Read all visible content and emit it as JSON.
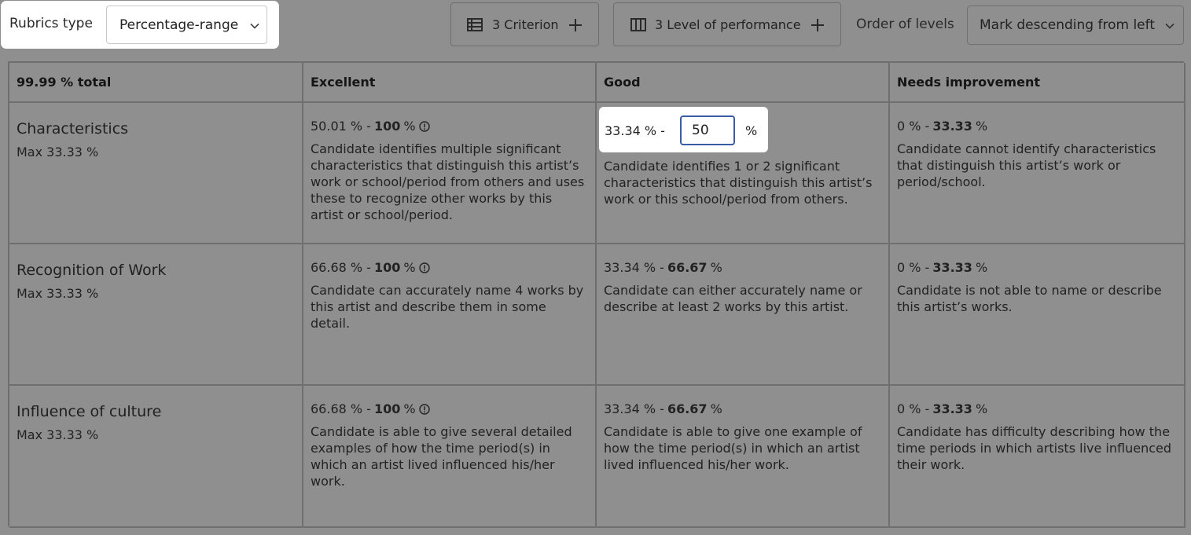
{
  "toolbar": {
    "rubrics_type_label": "Rubrics type",
    "rubrics_type_value": "Percentage-range",
    "criterion_button": "3 Criterion",
    "levels_button": "3 Level of performance",
    "order_label": "Order of levels",
    "order_value": "Mark descending from left"
  },
  "table": {
    "total_header": "99.99 % total",
    "levels": [
      "Excellent",
      "Good",
      "Needs improvement"
    ],
    "criteria": [
      {
        "name": "Characteristics",
        "max": "Max 33.33 %",
        "cells": [
          {
            "from": "50.01 % -",
            "to": "100",
            "unit": "%",
            "desc": "Candidate identifies multiple significant characteristics that distinguish this artist’s work or school/period from others and uses these to recognize other works by this artist or school/period."
          },
          {
            "from": "33.34 % -",
            "to": "50",
            "unit": "%",
            "desc": "Candidate identifies 1 or 2 significant characteristics that distinguish this artist’s work or this school/period from others."
          },
          {
            "from": "0 % -",
            "to": "33.33",
            "unit": "%",
            "desc": "Candidate cannot identify characteristics that distinguish this artist’s work or period/school."
          }
        ]
      },
      {
        "name": "Recognition of Work",
        "max": "Max 33.33 %",
        "cells": [
          {
            "from": "66.68 % -",
            "to": "100",
            "unit": "%",
            "desc": "Candidate can accurately name 4 works by this artist and describe them in some detail."
          },
          {
            "from": "33.34 % -",
            "to": "66.67",
            "unit": "%",
            "desc": "Candidate can either accurately name or describe at least 2 works by this artist."
          },
          {
            "from": "0 % -",
            "to": "33.33",
            "unit": "%",
            "desc": "Candidate is not able to name or describe this artist’s works."
          }
        ]
      },
      {
        "name": "Influence of culture",
        "max": "Max 33.33 %",
        "cells": [
          {
            "from": "66.68 % -",
            "to": "100",
            "unit": "%",
            "desc": "Candidate is able to give several detailed examples of how the time period(s) in which an artist lived influenced his/her work."
          },
          {
            "from": "33.34 % -",
            "to": "66.67",
            "unit": "%",
            "desc": "Candidate is able to give one example of how the time period(s) in which an artist lived influenced his/her work."
          },
          {
            "from": "0 % -",
            "to": "33.33",
            "unit": "%",
            "desc": "Candidate has difficulty describing how the time periods in which artists live influenced their work."
          }
        ]
      }
    ]
  },
  "icons": {
    "info": "info-circle-icon",
    "list": "list-icon",
    "columns": "columns-icon",
    "plus": "plus-icon",
    "chevron": "chevron-down-icon"
  },
  "colors": {
    "overlay": "#8f8f8f",
    "spotlight": "#ffffff",
    "focus_border": "#3a5ba8"
  }
}
